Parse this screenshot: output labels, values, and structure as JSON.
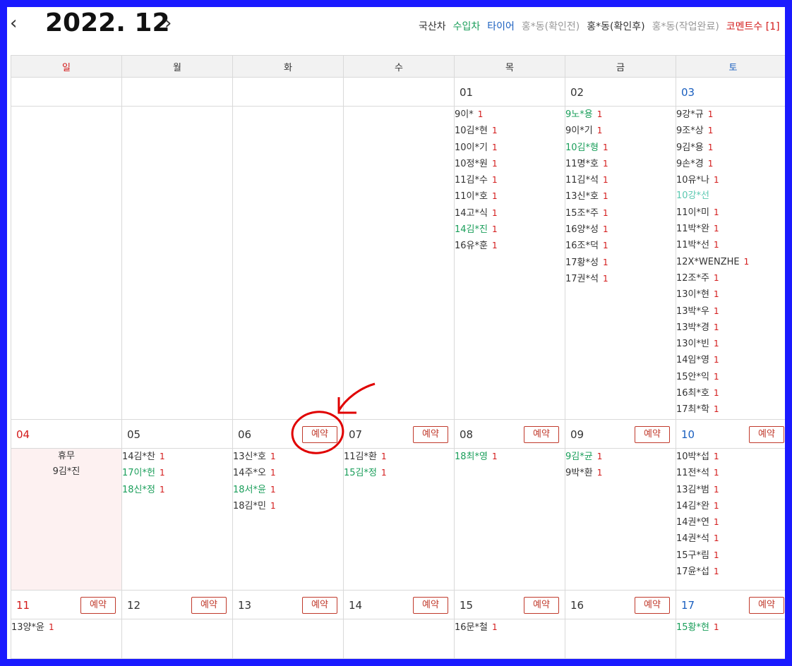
{
  "header": {
    "prev_icon": "‹",
    "next_icon": "›",
    "month_title": "2022. 12"
  },
  "legend": [
    {
      "text": "국산차",
      "color_class": "c-dark"
    },
    {
      "text": "수입차",
      "color_class": "c-green"
    },
    {
      "text": "타이어",
      "color_class": "c-blue"
    },
    {
      "text": "홍*동(확인전)",
      "color_class": "lg-gray"
    },
    {
      "text": "홍*동(확인후)",
      "color_class": "lg-dark"
    },
    {
      "text": "홍*동(작업완료)",
      "color_class": "lg-gray"
    },
    {
      "text": "코멘트수 [1]",
      "color_class": "c-red"
    }
  ],
  "weekdays": [
    "일",
    "월",
    "화",
    "수",
    "목",
    "금",
    "토"
  ],
  "reserve_label": "예약",
  "colors": {
    "domestic": "#333333",
    "imported": "#1a9e5a",
    "tire": "#1a5fbf",
    "comment_count": "#d31a1a",
    "sunday": "#d31a1a",
    "saturday": "#1a5fbf"
  },
  "weeks": [
    {
      "days": [
        {
          "date": "",
          "entries": []
        },
        {
          "date": "",
          "entries": []
        },
        {
          "date": "",
          "entries": []
        },
        {
          "date": "",
          "entries": []
        },
        {
          "date": "01",
          "entries": [
            {
              "text": "9이*",
              "color": "c-dark",
              "count": "1"
            },
            {
              "text": "10김*현",
              "color": "c-dark",
              "count": "1"
            },
            {
              "text": "10이*기",
              "color": "c-dark",
              "count": "1"
            },
            {
              "text": "10정*원",
              "color": "c-dark",
              "count": "1"
            },
            {
              "text": "11김*수",
              "color": "c-dark",
              "count": "1"
            },
            {
              "text": "11이*호",
              "color": "c-dark",
              "count": "1"
            },
            {
              "text": "14고*식",
              "color": "c-dark",
              "count": "1"
            },
            {
              "text": "14김*진",
              "color": "c-green",
              "count": "1"
            },
            {
              "text": "16유*훈",
              "color": "c-dark",
              "count": "1"
            }
          ]
        },
        {
          "date": "02",
          "entries": [
            {
              "text": "9노*용",
              "color": "c-green",
              "count": "1"
            },
            {
              "text": "9이*기",
              "color": "c-dark",
              "count": "1"
            },
            {
              "text": "10김*형",
              "color": "c-green",
              "count": "1"
            },
            {
              "text": "11명*호",
              "color": "c-dark",
              "count": "1"
            },
            {
              "text": "11김*석",
              "color": "c-dark",
              "count": "1"
            },
            {
              "text": "13신*호",
              "color": "c-dark",
              "count": "1"
            },
            {
              "text": "15조*주",
              "color": "c-dark",
              "count": "1"
            },
            {
              "text": "16양*성",
              "color": "c-dark",
              "count": "1"
            },
            {
              "text": "16조*덕",
              "color": "c-dark",
              "count": "1"
            },
            {
              "text": "17황*성",
              "color": "c-dark",
              "count": "1"
            },
            {
              "text": "17권*석",
              "color": "c-dark",
              "count": "1"
            }
          ]
        },
        {
          "date": "03",
          "entries": [
            {
              "text": "9강*규",
              "color": "c-dark",
              "count": "1"
            },
            {
              "text": "9조*상",
              "color": "c-dark",
              "count": "1"
            },
            {
              "text": "9김*용",
              "color": "c-dark",
              "count": "1"
            },
            {
              "text": "9손*경",
              "color": "c-dark",
              "count": "1"
            },
            {
              "text": "10유*나",
              "color": "c-dark",
              "count": "1"
            },
            {
              "text": "10강*선",
              "color": "c-mint",
              "count": ""
            },
            {
              "text": "11이*미",
              "color": "c-dark",
              "count": "1"
            },
            {
              "text": "11박*완",
              "color": "c-dark",
              "count": "1"
            },
            {
              "text": "11박*선",
              "color": "c-dark",
              "count": "1"
            },
            {
              "text": "12X*WENZHE",
              "color": "c-dark",
              "count": "1"
            },
            {
              "text": "12조*주",
              "color": "c-dark",
              "count": "1"
            },
            {
              "text": "13이*현",
              "color": "c-dark",
              "count": "1"
            },
            {
              "text": "13박*우",
              "color": "c-dark",
              "count": "1"
            },
            {
              "text": "13박*경",
              "color": "c-dark",
              "count": "1"
            },
            {
              "text": "13이*빈",
              "color": "c-dark",
              "count": "1"
            },
            {
              "text": "14임*영",
              "color": "c-dark",
              "count": "1"
            },
            {
              "text": "15안*익",
              "color": "c-dark",
              "count": "1"
            },
            {
              "text": "16최*호",
              "color": "c-dark",
              "count": "1"
            },
            {
              "text": "17최*학",
              "color": "c-dark",
              "count": "1"
            }
          ]
        }
      ]
    },
    {
      "days": [
        {
          "date": "04",
          "holiday": true,
          "holiday_label": "휴무",
          "holiday_sub": "9김*진",
          "entries": []
        },
        {
          "date": "05",
          "entries": [
            {
              "text": "14김*찬",
              "color": "c-dark",
              "count": "1"
            },
            {
              "text": "17이*헌",
              "color": "c-green",
              "count": "1"
            },
            {
              "text": "18신*정",
              "color": "c-green",
              "count": "1"
            }
          ]
        },
        {
          "date": "06",
          "button": true,
          "entries": [
            {
              "text": "13신*호",
              "color": "c-dark",
              "count": "1"
            },
            {
              "text": "14주*오",
              "color": "c-dark",
              "count": "1"
            },
            {
              "text": "18서*윤",
              "color": "c-green",
              "count": "1"
            },
            {
              "text": "18김*민",
              "color": "c-dark",
              "count": "1"
            }
          ]
        },
        {
          "date": "07",
          "button": true,
          "entries": [
            {
              "text": "11김*환",
              "color": "c-dark",
              "count": "1"
            },
            {
              "text": "15김*정",
              "color": "c-green",
              "count": "1"
            }
          ]
        },
        {
          "date": "08",
          "button": true,
          "entries": [
            {
              "text": "18최*영",
              "color": "c-green",
              "count": "1"
            }
          ]
        },
        {
          "date": "09",
          "button": true,
          "entries": [
            {
              "text": "9김*균",
              "color": "c-green",
              "count": "1"
            },
            {
              "text": "9박*환",
              "color": "c-dark",
              "count": "1"
            }
          ]
        },
        {
          "date": "10",
          "button": true,
          "entries": [
            {
              "text": "10박*섭",
              "color": "c-dark",
              "count": "1"
            },
            {
              "text": "11전*석",
              "color": "c-dark",
              "count": "1"
            },
            {
              "text": "13김*범",
              "color": "c-dark",
              "count": "1"
            },
            {
              "text": "14김*완",
              "color": "c-dark",
              "count": "1"
            },
            {
              "text": "14권*연",
              "color": "c-dark",
              "count": "1"
            },
            {
              "text": "14권*석",
              "color": "c-dark",
              "count": "1"
            },
            {
              "text": "15구*림",
              "color": "c-dark",
              "count": "1"
            },
            {
              "text": "17윤*섭",
              "color": "c-dark",
              "count": "1"
            }
          ]
        }
      ]
    },
    {
      "days": [
        {
          "date": "11",
          "button": true,
          "entries": [
            {
              "text": "13양*윤",
              "color": "c-dark",
              "count": "1"
            }
          ]
        },
        {
          "date": "12",
          "button": true,
          "entries": []
        },
        {
          "date": "13",
          "button": true,
          "entries": []
        },
        {
          "date": "14",
          "button": true,
          "entries": []
        },
        {
          "date": "15",
          "button": true,
          "entries": [
            {
              "text": "16문*철",
              "color": "c-dark",
              "count": "1"
            }
          ]
        },
        {
          "date": "16",
          "button": true,
          "entries": []
        },
        {
          "date": "17",
          "button": true,
          "entries": [
            {
              "text": "15황*현",
              "color": "c-green",
              "count": "1"
            }
          ]
        }
      ]
    }
  ]
}
